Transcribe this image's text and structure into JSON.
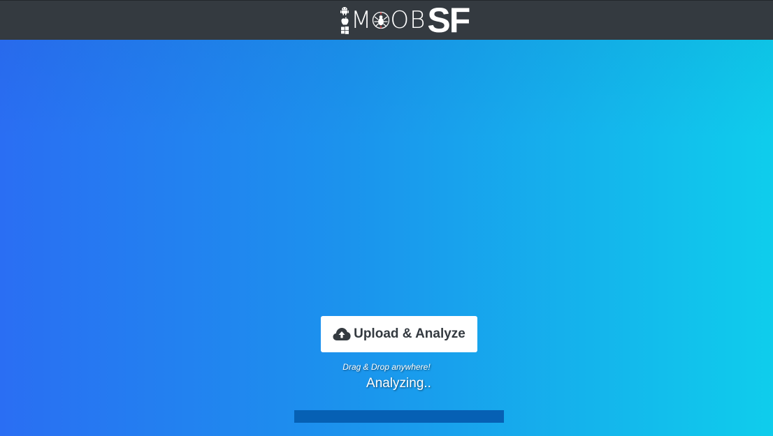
{
  "header": {
    "logo_text_left": "MOB",
    "logo_text_right": "SF",
    "platform_icons": [
      "android-icon",
      "apple-icon",
      "windows-icon"
    ],
    "bug_icon": "bug-icon"
  },
  "main": {
    "upload_button": {
      "icon": "cloud-upload-icon",
      "label": "Upload & Analyze"
    },
    "drag_hint": "Drag & Drop anywhere!",
    "status": "Analyzing..",
    "progress": 1.0
  },
  "colors": {
    "header_bg": "#343a40",
    "gradient_start": "#2a6ef3",
    "gradient_end": "#0fcdec",
    "progress_bar": "#0660b4",
    "button_text": "#343a40"
  }
}
